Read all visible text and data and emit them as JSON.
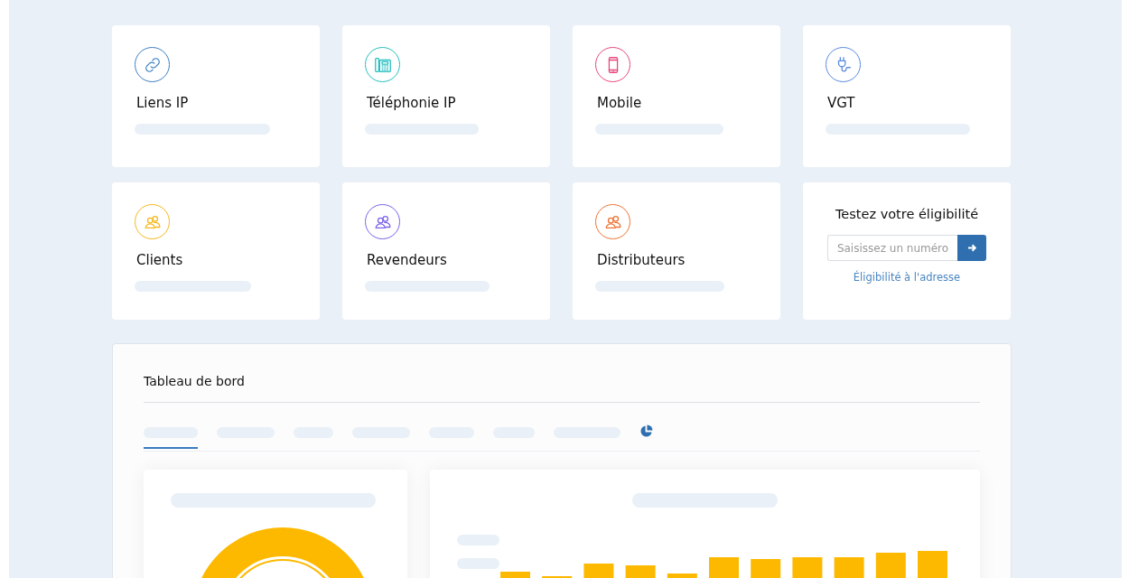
{
  "cards": [
    {
      "kind": "link",
      "title": "Liens IP",
      "color": "#3d7fc1"
    },
    {
      "kind": "phone",
      "title": "Téléphonie IP",
      "color": "#27bfc0"
    },
    {
      "kind": "mobile",
      "title": "Mobile",
      "color": "#e8497a"
    },
    {
      "kind": "plug",
      "title": "VGT",
      "color": "#5b8be0"
    },
    {
      "kind": "people",
      "title": "Clients",
      "color": "#f6b81c"
    },
    {
      "kind": "people",
      "title": "Revendeurs",
      "color": "#7d62ea"
    },
    {
      "kind": "people",
      "title": "Distributeurs",
      "color": "#ee7434"
    }
  ],
  "eligibility": {
    "title": "Testez votre éligibilité",
    "placeholder": "Saisissez un numéro",
    "address_link": "Éligibilité à l'adresse"
  },
  "dashboard": {
    "title": "Tableau de bord",
    "tabs": [
      {
        "selected": true
      },
      {
        "selected": false
      },
      {
        "selected": false
      },
      {
        "selected": false
      },
      {
        "selected": false
      },
      {
        "selected": false
      },
      {
        "selected": false
      }
    ]
  }
}
